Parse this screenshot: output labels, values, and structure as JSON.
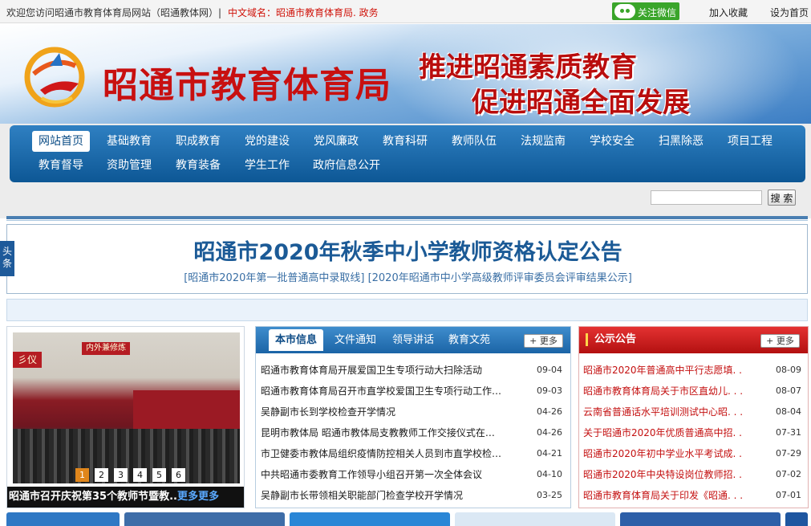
{
  "topbar": {
    "welcome": "欢迎您访问昭通市教育体育局网站（昭通教体网）|",
    "domain": "中文域名：昭通市教育体育局. 政务",
    "wechat": "关注微信",
    "favorite": "加入收藏",
    "homepage": "设为首页"
  },
  "banner": {
    "site_title": "昭通市教育体育局",
    "slogan_line1": "推进昭通素质教育",
    "slogan_line2": "促进昭通全面发展"
  },
  "nav": {
    "items": [
      "网站首页",
      "基础教育",
      "职成教育",
      "党的建设",
      "党风廉政",
      "教育科研",
      "教师队伍",
      "法规监南",
      "学校安全",
      "扫黑除恶",
      "项目工程",
      "教育督导",
      "资助管理",
      "教育装备",
      "学生工作",
      "政府信息公开"
    ]
  },
  "search": {
    "button": "搜 索",
    "placeholder": ""
  },
  "headline": {
    "tab": "头条",
    "title": "昭通市2020年秋季中小学教师资格认定公告",
    "links": "[昭通市2020年第一批普通高中录取线]  [2020年昭通市中小学高级教师评审委员会评审结果公示]"
  },
  "photo": {
    "pager": [
      "1",
      "2",
      "3",
      "4",
      "5",
      "6"
    ],
    "caption": "昭通市召开庆祝第35个教师节暨教..",
    "caption_more": "更多更多"
  },
  "news": {
    "tabs": [
      "本市信息",
      "文件通知",
      "领导讲话",
      "教育文苑"
    ],
    "more": "+ 更多",
    "rows": [
      {
        "title": "昭通市教育体育局开展爱国卫生专项行动大扫除活动",
        "date": "09-04"
      },
      {
        "title": "昭通市教育体育局召开市直学校爱国卫生专项行动工作…",
        "date": "09-03"
      },
      {
        "title": "吴静副市长到学校检查开学情况",
        "date": "04-26"
      },
      {
        "title": "昆明市教体局 昭通市教体局支教教师工作交接仪式在…",
        "date": "04-26"
      },
      {
        "title": "市卫健委市教体局组织疫情防控相关人员到市直学校检…",
        "date": "04-21"
      },
      {
        "title": "中共昭通市委教育工作领导小组召开第一次全体会议",
        "date": "04-10"
      },
      {
        "title": "吴静副市长带领相关职能部门检查学校开学情况",
        "date": "03-25"
      }
    ]
  },
  "notice": {
    "title": "公示公告",
    "more": "+ 更多",
    "rows": [
      {
        "title": "昭通市2020年普通高中平行志愿填. . .",
        "date": "08-09"
      },
      {
        "title": "昭通市教育体育局关于市区直幼儿. . .",
        "date": "08-07"
      },
      {
        "title": "云南省普通话水平培训测试中心昭. . .",
        "date": "08-04"
      },
      {
        "title": "关于昭通市2020年优质普通高中招. . .",
        "date": "07-31"
      },
      {
        "title": "昭通市2020年初中学业水平考试成. . .",
        "date": "07-29"
      },
      {
        "title": "昭通市2020年中央特设岗位教师招. . .",
        "date": "07-02"
      },
      {
        "title": "昭通市教育体育局关于印发《昭通. . .",
        "date": "07-01"
      }
    ]
  },
  "colors": {
    "nav_blue": "#1b64a6",
    "accent_red": "#c81010",
    "wechat_green": "#3aa52a"
  }
}
